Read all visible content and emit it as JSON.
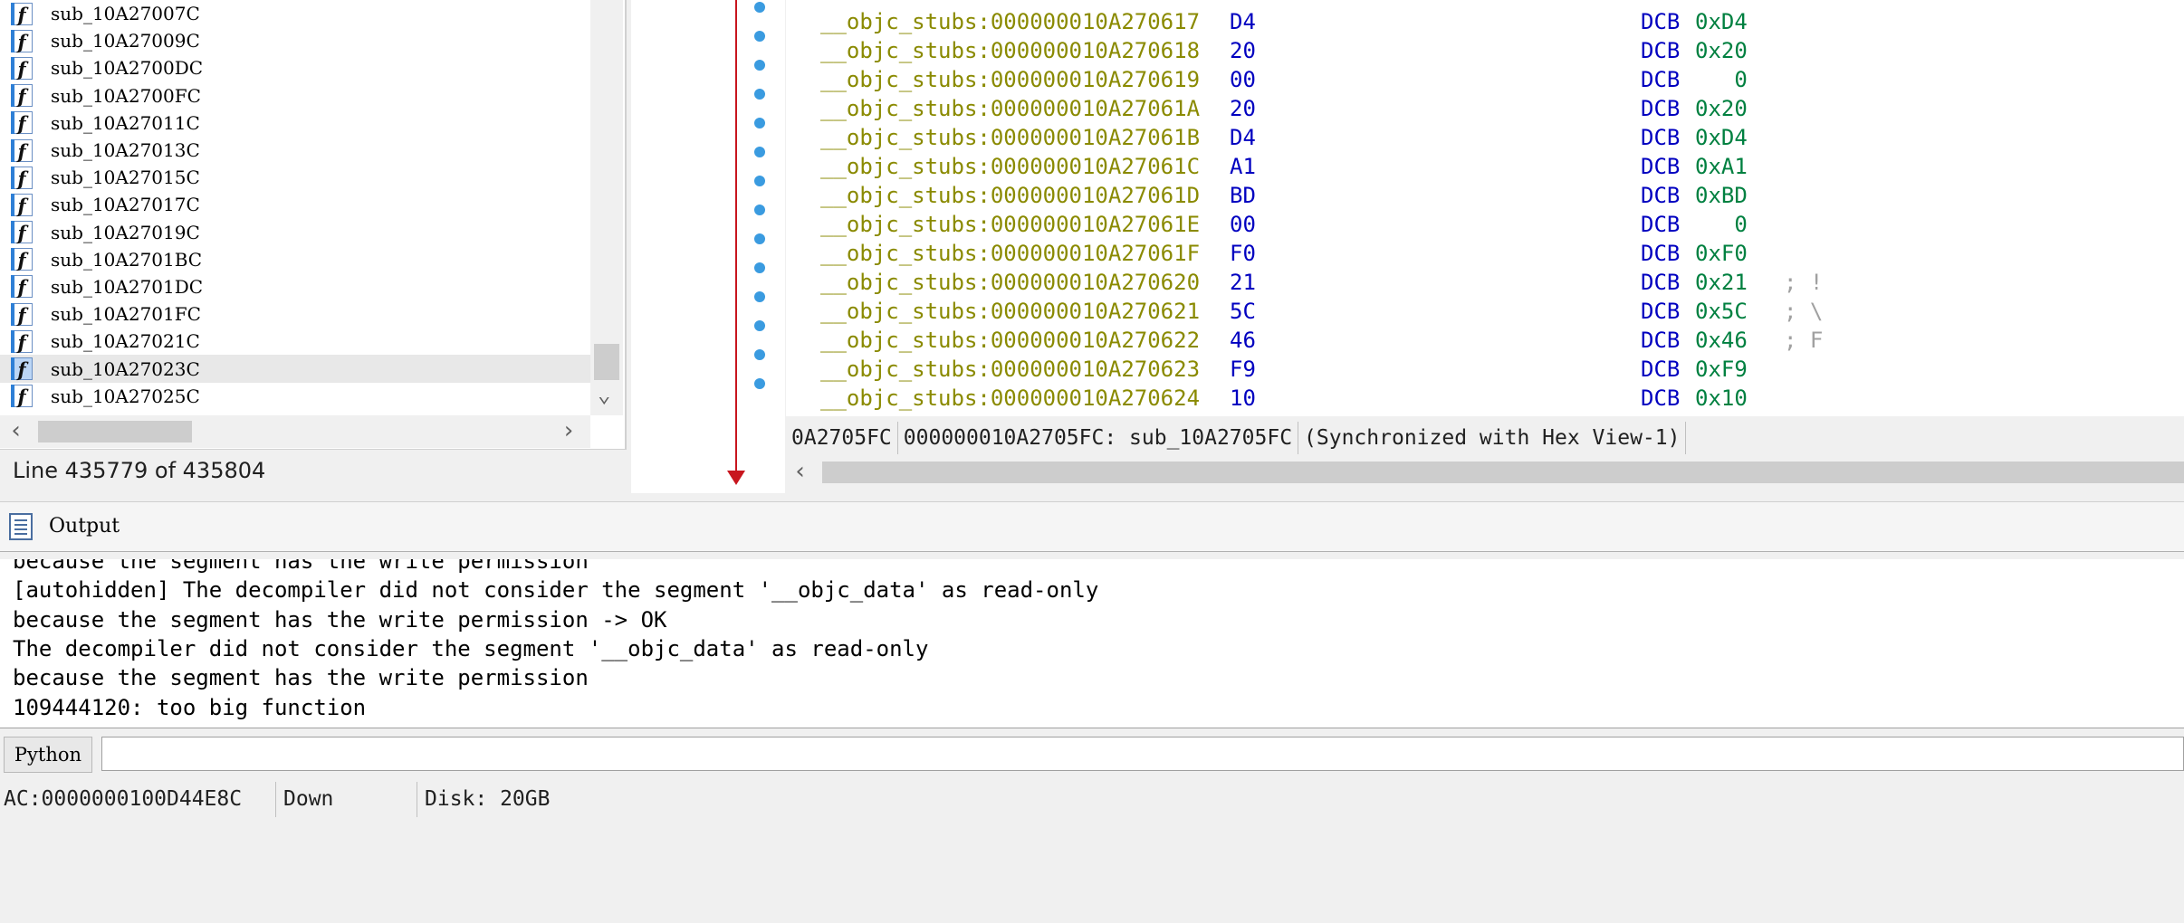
{
  "functions": {
    "items": [
      {
        "name": "sub_10A27007C"
      },
      {
        "name": "sub_10A27009C"
      },
      {
        "name": "sub_10A2700DC"
      },
      {
        "name": "sub_10A2700FC"
      },
      {
        "name": "sub_10A27011C"
      },
      {
        "name": "sub_10A27013C"
      },
      {
        "name": "sub_10A27015C"
      },
      {
        "name": "sub_10A27017C"
      },
      {
        "name": "sub_10A27019C"
      },
      {
        "name": "sub_10A2701BC"
      },
      {
        "name": "sub_10A2701DC"
      },
      {
        "name": "sub_10A2701FC"
      },
      {
        "name": "sub_10A27021C"
      },
      {
        "name": "sub_10A27023C",
        "selected": true
      },
      {
        "name": "sub_10A27025C"
      }
    ],
    "icon_glyph": "f",
    "line_status": "Line 435779 of 435804"
  },
  "listing": {
    "rows": [
      {
        "addr": "__objc_stubs:000000010A270617",
        "byte": "D4",
        "mnem": "DCB",
        "op": "0xD4",
        "comment": ""
      },
      {
        "addr": "__objc_stubs:000000010A270618",
        "byte": "20",
        "mnem": "DCB",
        "op": "0x20",
        "comment": ""
      },
      {
        "addr": "__objc_stubs:000000010A270619",
        "byte": "00",
        "mnem": "DCB",
        "op": "   0",
        "comment": ""
      },
      {
        "addr": "__objc_stubs:000000010A27061A",
        "byte": "20",
        "mnem": "DCB",
        "op": "0x20",
        "comment": ""
      },
      {
        "addr": "__objc_stubs:000000010A27061B",
        "byte": "D4",
        "mnem": "DCB",
        "op": "0xD4",
        "comment": ""
      },
      {
        "addr": "__objc_stubs:000000010A27061C",
        "byte": "A1",
        "mnem": "DCB",
        "op": "0xA1",
        "comment": ""
      },
      {
        "addr": "__objc_stubs:000000010A27061D",
        "byte": "BD",
        "mnem": "DCB",
        "op": "0xBD",
        "comment": ""
      },
      {
        "addr": "__objc_stubs:000000010A27061E",
        "byte": "00",
        "mnem": "DCB",
        "op": "   0",
        "comment": ""
      },
      {
        "addr": "__objc_stubs:000000010A27061F",
        "byte": "F0",
        "mnem": "DCB",
        "op": "0xF0",
        "comment": ""
      },
      {
        "addr": "__objc_stubs:000000010A270620",
        "byte": "21",
        "mnem": "DCB",
        "op": "0x21",
        "comment": "; !"
      },
      {
        "addr": "__objc_stubs:000000010A270621",
        "byte": "5C",
        "mnem": "DCB",
        "op": "0x5C",
        "comment": "; \\"
      },
      {
        "addr": "__objc_stubs:000000010A270622",
        "byte": "46",
        "mnem": "DCB",
        "op": "0x46",
        "comment": "; F"
      },
      {
        "addr": "__objc_stubs:000000010A270623",
        "byte": "F9",
        "mnem": "DCB",
        "op": "0xF9",
        "comment": ""
      },
      {
        "addr": "__objc_stubs:000000010A270624",
        "byte": "10",
        "mnem": "DCB",
        "op": "0x10",
        "comment": ""
      }
    ],
    "sync_bar": {
      "segment_offset": "0A2705FC",
      "location": "000000010A2705FC: sub_10A2705FC",
      "sync": "(Synchronized with Hex View-1)"
    }
  },
  "output": {
    "title": "Output",
    "lines": [
      "because the segment has the write permission",
      "[autohidden] The decompiler did not consider the segment '__objc_data' as read-only",
      "because the segment has the write permission -> OK",
      "The decompiler did not consider the segment '__objc_data' as read-only",
      "because the segment has the write permission",
      "109444120: too big function"
    ]
  },
  "python": {
    "button_label": "Python",
    "input_value": ""
  },
  "status": {
    "address": "AC:0000000100D44E8C",
    "direction": "Down",
    "disk": "Disk: 20GB"
  },
  "colors": {
    "address": "#8a8a00",
    "bytes": "#0000c0",
    "operand": "#008040",
    "arrow": "#c8161e",
    "dot": "#3a9be0"
  }
}
